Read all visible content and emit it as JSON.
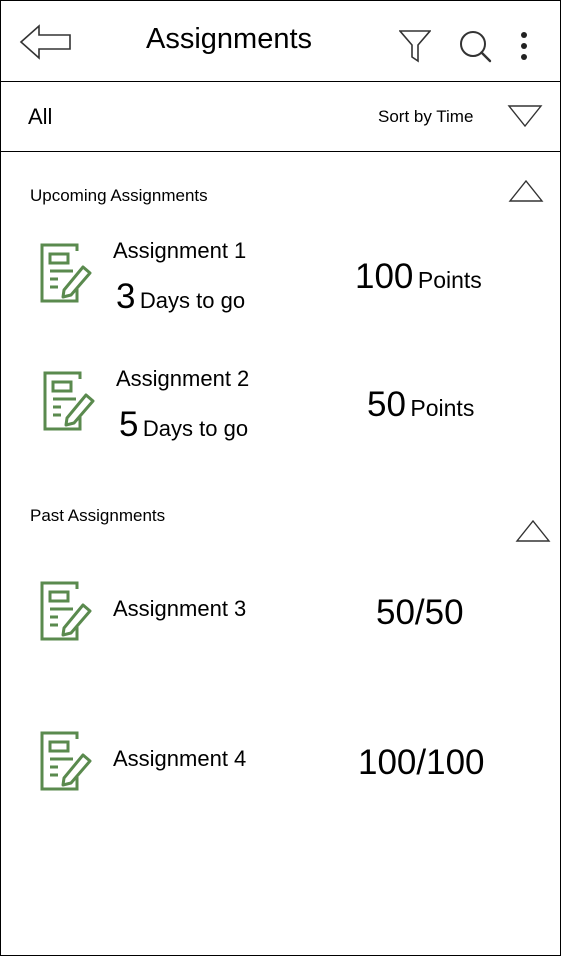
{
  "header": {
    "title": "Assignments",
    "icons": [
      "back-arrow-icon",
      "filter-icon",
      "search-icon",
      "more-vertical-icon"
    ]
  },
  "toolbar": {
    "filter_label": "All",
    "sort_label": "Sort by Time",
    "sort_icon": "chevron-down-triangle-icon"
  },
  "colors": {
    "icon_green": "#5a8a4e",
    "border": "#000000"
  },
  "sections": {
    "upcoming": {
      "title": "Upcoming Assignments",
      "collapse_icon": "chevron-up-triangle-icon",
      "items": [
        {
          "name": "Assignment 1",
          "days": "3",
          "days_label": "Days to go",
          "points": "100",
          "points_label": "Points",
          "icon": "assignment-edit-icon"
        },
        {
          "name": "Assignment 2",
          "days": "5",
          "days_label": "Days to go",
          "points": "50",
          "points_label": "Points",
          "icon": "assignment-edit-icon"
        }
      ]
    },
    "past": {
      "title": "Past Assignments",
      "collapse_icon": "chevron-up-triangle-icon",
      "items": [
        {
          "name": "Assignment 3",
          "score": "50/50",
          "icon": "assignment-edit-icon"
        },
        {
          "name": "Assignment 4",
          "score": "100/100",
          "icon": "assignment-edit-icon"
        }
      ]
    }
  }
}
